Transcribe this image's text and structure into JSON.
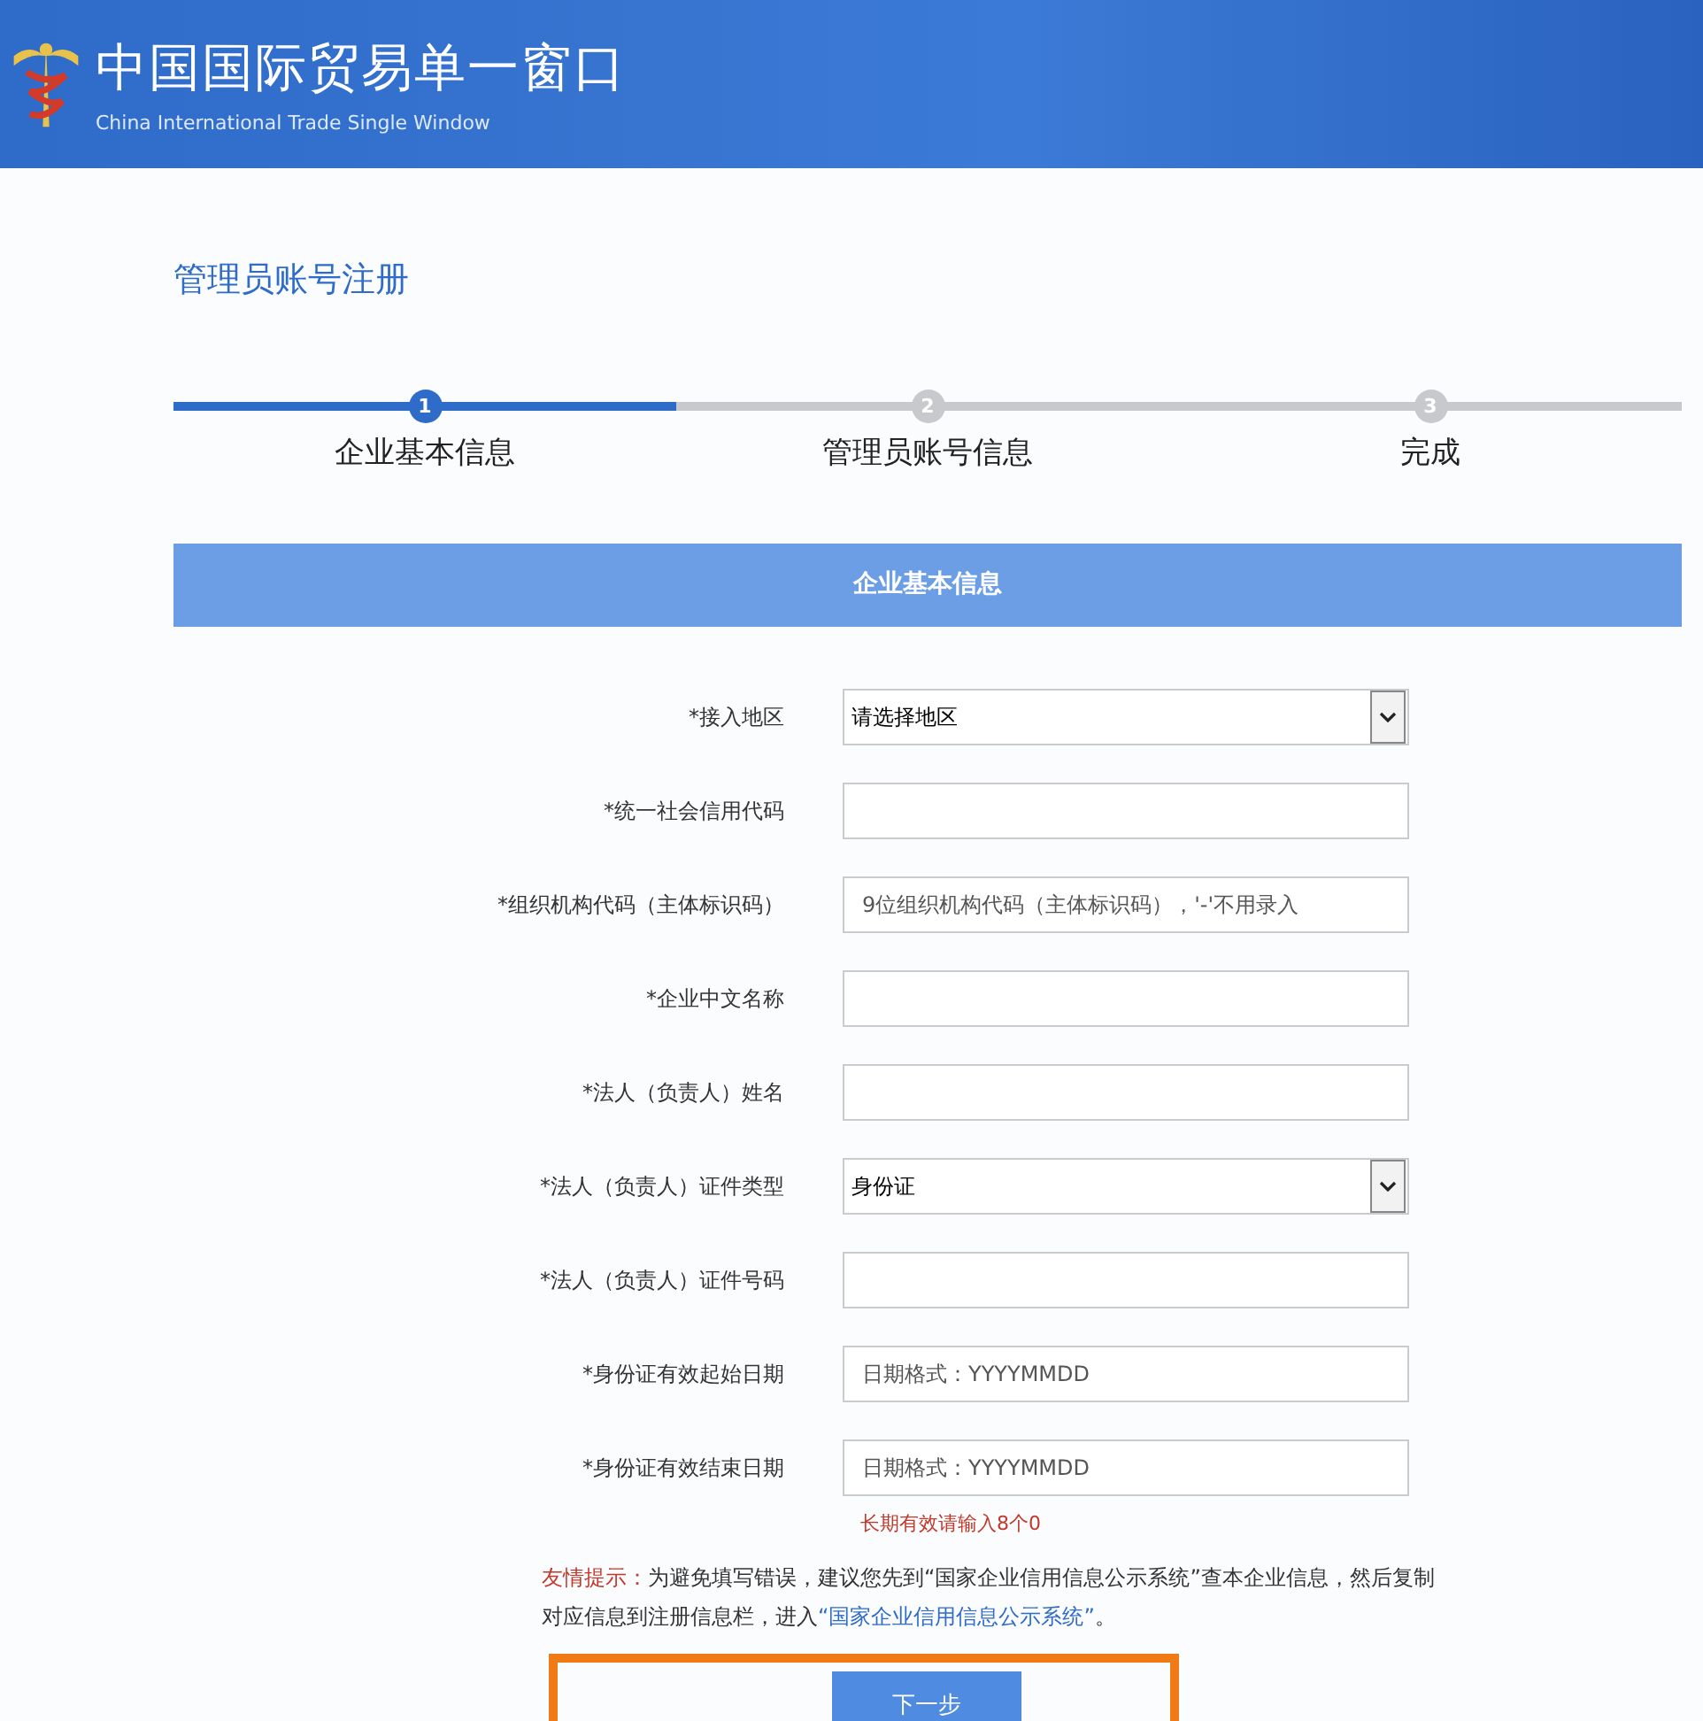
{
  "header": {
    "title": "中国国际贸易单一窗口",
    "subtitle": "China International Trade Single Window"
  },
  "page_title": "管理员账号注册",
  "steps": [
    {
      "number": "1",
      "label": "企业基本信息",
      "selected": true
    },
    {
      "number": "2",
      "label": "管理员账号信息",
      "selected": false
    },
    {
      "number": "3",
      "label": "完成",
      "selected": false
    }
  ],
  "panel": {
    "title": "企业基本信息"
  },
  "fields": [
    {
      "kind": "select",
      "label": "*接入地区",
      "value": "请选择地区"
    },
    {
      "kind": "text",
      "label": "*统一社会信用代码"
    },
    {
      "kind": "text",
      "label": "*组织机构代码（主体标识码）",
      "placeholder": "9位组织机构代码（主体标识码），'-'不用录入"
    },
    {
      "kind": "text",
      "label": "*企业中文名称"
    },
    {
      "kind": "text",
      "label": "*法人（负责人）姓名"
    },
    {
      "kind": "select",
      "label": "*法人（负责人）证件类型",
      "value": "身份证"
    },
    {
      "kind": "text",
      "label": "*法人（负责人）证件号码"
    },
    {
      "kind": "text",
      "label": "*身份证有效起始日期",
      "placeholder": "日期格式：YYYYMMDD"
    },
    {
      "kind": "text",
      "label": "*身份证有效结束日期",
      "placeholder": "日期格式：YYYYMMDD",
      "hint": "长期有效请输入8个0"
    }
  ],
  "tip": {
    "label": "友情提示：",
    "text": "为避免填写错误，建议您先到“国家企业信用信息公示系统”查本企业信息，然后复制对应信息到注册信息栏，进入",
    "link": "“国家企业信用信息公示系统”",
    "end": "。"
  },
  "next_button": "下一步"
}
